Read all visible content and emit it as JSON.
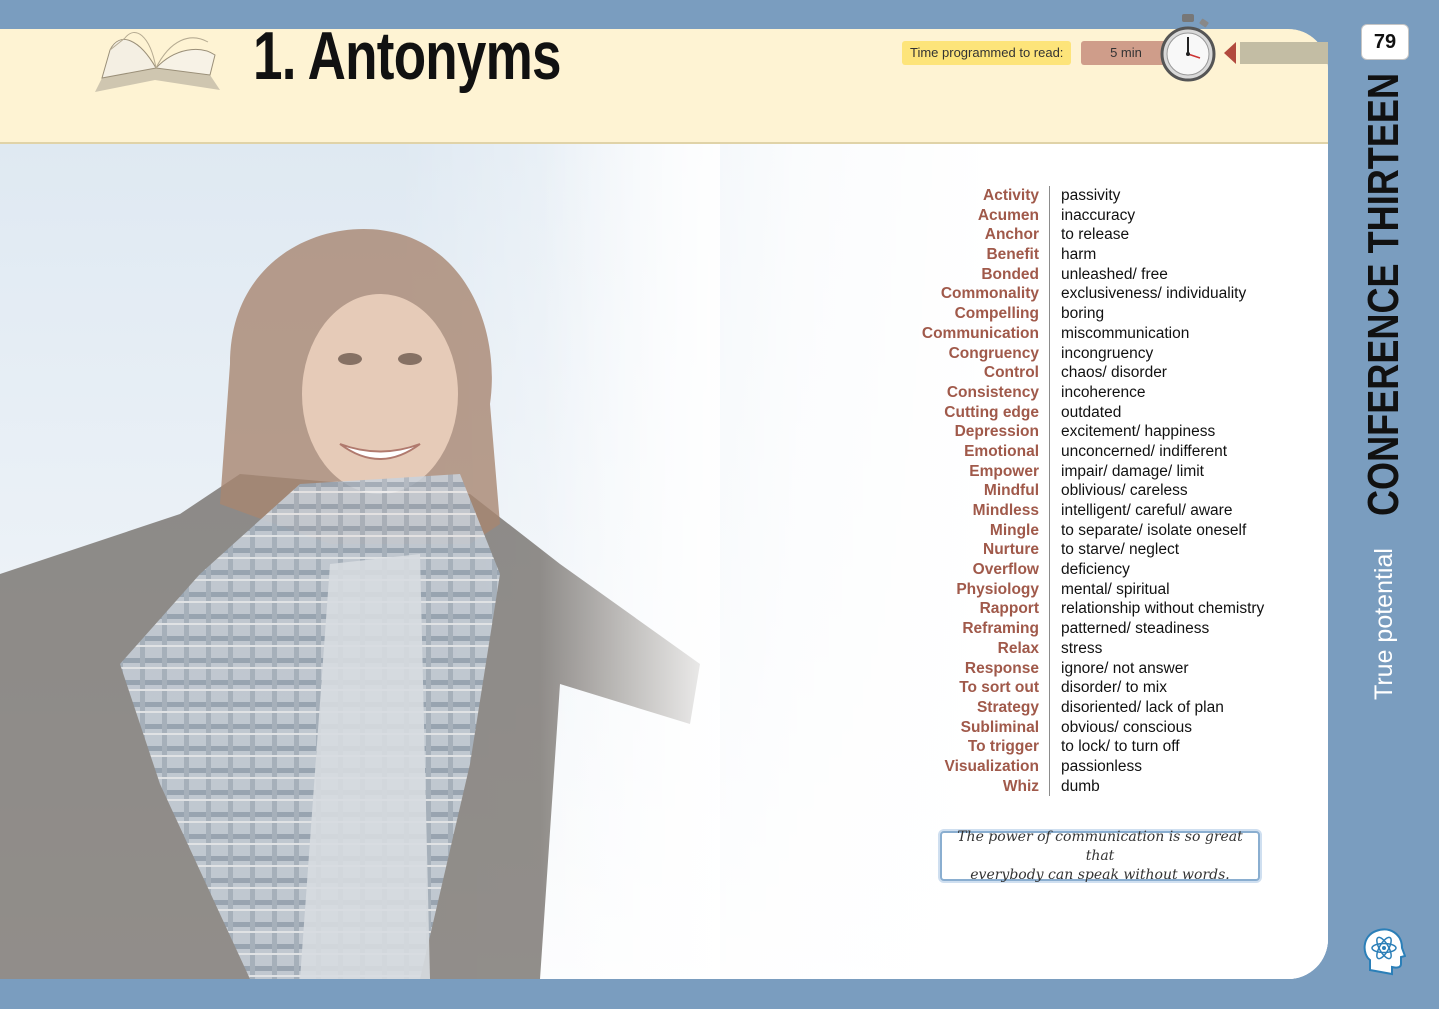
{
  "header": {
    "title": "1. Antonyms",
    "time_label": "Time programmed to read:",
    "time_value": "5 min"
  },
  "sidebar": {
    "page_number": "79",
    "section_light": "True potential",
    "section_bold": "CONFERENCE THIRTEEN"
  },
  "antonyms": [
    {
      "term": "Activity",
      "antonym": "passivity"
    },
    {
      "term": "Acumen",
      "antonym": "inaccuracy"
    },
    {
      "term": "Anchor",
      "antonym": "to release"
    },
    {
      "term": "Benefit",
      "antonym": "harm"
    },
    {
      "term": "Bonded",
      "antonym": "unleashed/ free"
    },
    {
      "term": "Commonality",
      "antonym": "exclusiveness/ individuality"
    },
    {
      "term": "Compelling",
      "antonym": "boring"
    },
    {
      "term": "Communication",
      "antonym": "miscommunication"
    },
    {
      "term": "Congruency",
      "antonym": "incongruency"
    },
    {
      "term": "Control",
      "antonym": "chaos/ disorder"
    },
    {
      "term": "Consistency",
      "antonym": "incoherence"
    },
    {
      "term": "Cutting edge",
      "antonym": "outdated"
    },
    {
      "term": "Depression",
      "antonym": "excitement/ happiness"
    },
    {
      "term": "Emotional",
      "antonym": "unconcerned/ indifferent"
    },
    {
      "term": "Empower",
      "antonym": "impair/ damage/ limit"
    },
    {
      "term": "Mindful",
      "antonym": "oblivious/ careless"
    },
    {
      "term": "Mindless",
      "antonym": "intelligent/ careful/ aware"
    },
    {
      "term": "Mingle",
      "antonym": "to separate/ isolate oneself"
    },
    {
      "term": "Nurture",
      "antonym": "to starve/ neglect"
    },
    {
      "term": "Overflow",
      "antonym": "deficiency"
    },
    {
      "term": "Physiology",
      "antonym": "mental/ spiritual"
    },
    {
      "term": "Rapport",
      "antonym": "relationship without chemistry"
    },
    {
      "term": "Reframing",
      "antonym": "patterned/ steadiness"
    },
    {
      "term": "Relax",
      "antonym": "stress"
    },
    {
      "term": "Response",
      "antonym": "ignore/ not answer"
    },
    {
      "term": "To sort out",
      "antonym": "disorder/ to mix"
    },
    {
      "term": "Strategy",
      "antonym": "disoriented/ lack of plan"
    },
    {
      "term": "Subliminal",
      "antonym": "obvious/ conscious"
    },
    {
      "term": "To trigger",
      "antonym": "to lock/ to turn off"
    },
    {
      "term": "Visualization",
      "antonym": "passionless"
    },
    {
      "term": "Whiz",
      "antonym": "dumb"
    }
  ],
  "quote": {
    "line1": "The power of communication is so great that",
    "line2": "everybody can speak without words."
  },
  "colors": {
    "term": "#a0594a",
    "frame": "#7a9dbf",
    "header_band": "#fef3d3",
    "time_label_bg": "#fde47a",
    "time_value_bg": "#cf9d8a"
  },
  "icons": [
    "open-book-icon",
    "stopwatch-icon",
    "arrow-left-icon",
    "head-atom-icon"
  ]
}
